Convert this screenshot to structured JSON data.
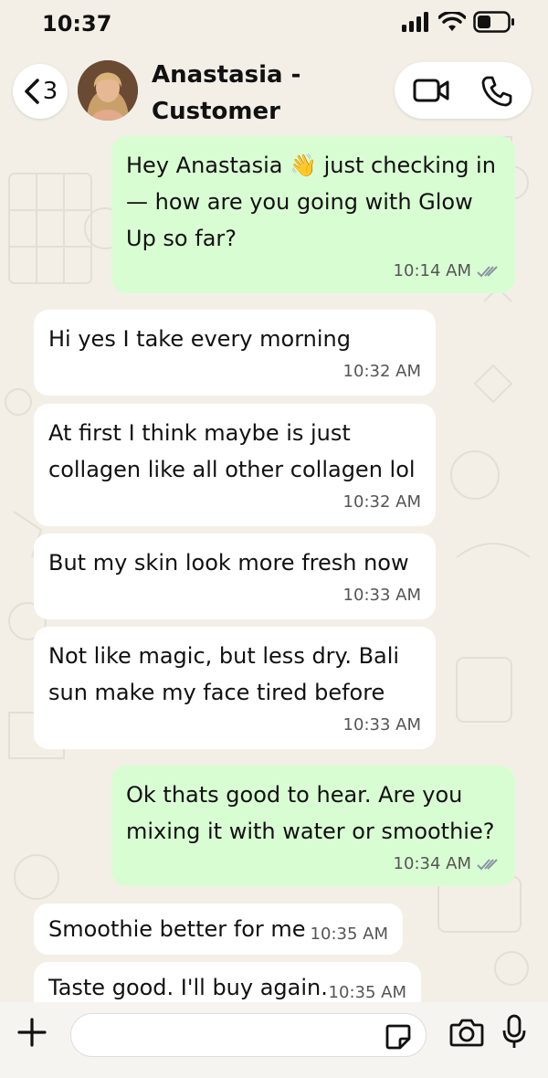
{
  "status_bar": {
    "time": "10:37"
  },
  "header": {
    "back_count": "3",
    "contact_name": "Anastasia - Customer"
  },
  "messages": [
    {
      "direction": "out",
      "text": "Hey Anastasia 👋 just checking in — how are you going with Glow Up so far?",
      "time": "10:14 AM",
      "read": true
    },
    {
      "direction": "in",
      "text": "Hi yes I take every morning",
      "time": "10:32 AM"
    },
    {
      "direction": "in",
      "text": "At first I think maybe is just collagen like all other collagen lol",
      "time": "10:32 AM"
    },
    {
      "direction": "in",
      "text": "But my skin look more fresh now",
      "time": "10:33 AM"
    },
    {
      "direction": "in",
      "text": "Not like magic, but less dry. Bali sun make my face tired before",
      "time": "10:33 AM"
    },
    {
      "direction": "out",
      "text": "Ok thats good to hear. Are you mixing it with water or smoothie?",
      "time": "10:34 AM",
      "read": true
    },
    {
      "direction": "in",
      "text": "Smoothie better for me",
      "time": "10:35 AM"
    },
    {
      "direction": "in",
      "text": "Taste good. I'll buy again.",
      "time": "10:35 AM"
    }
  ],
  "composer": {
    "placeholder": ""
  },
  "icons": {
    "back": "chevron-left-icon",
    "video": "video-camera-icon",
    "call": "phone-icon",
    "add": "plus-icon",
    "sticker": "sticker-icon",
    "camera": "camera-icon",
    "mic": "microphone-icon",
    "read_receipt": "double-check-icon"
  },
  "colors": {
    "background": "#f3efe7",
    "outgoing_bubble": "#d9fdd3",
    "incoming_bubble": "#ffffff",
    "read_tick": "#8a94a6"
  }
}
